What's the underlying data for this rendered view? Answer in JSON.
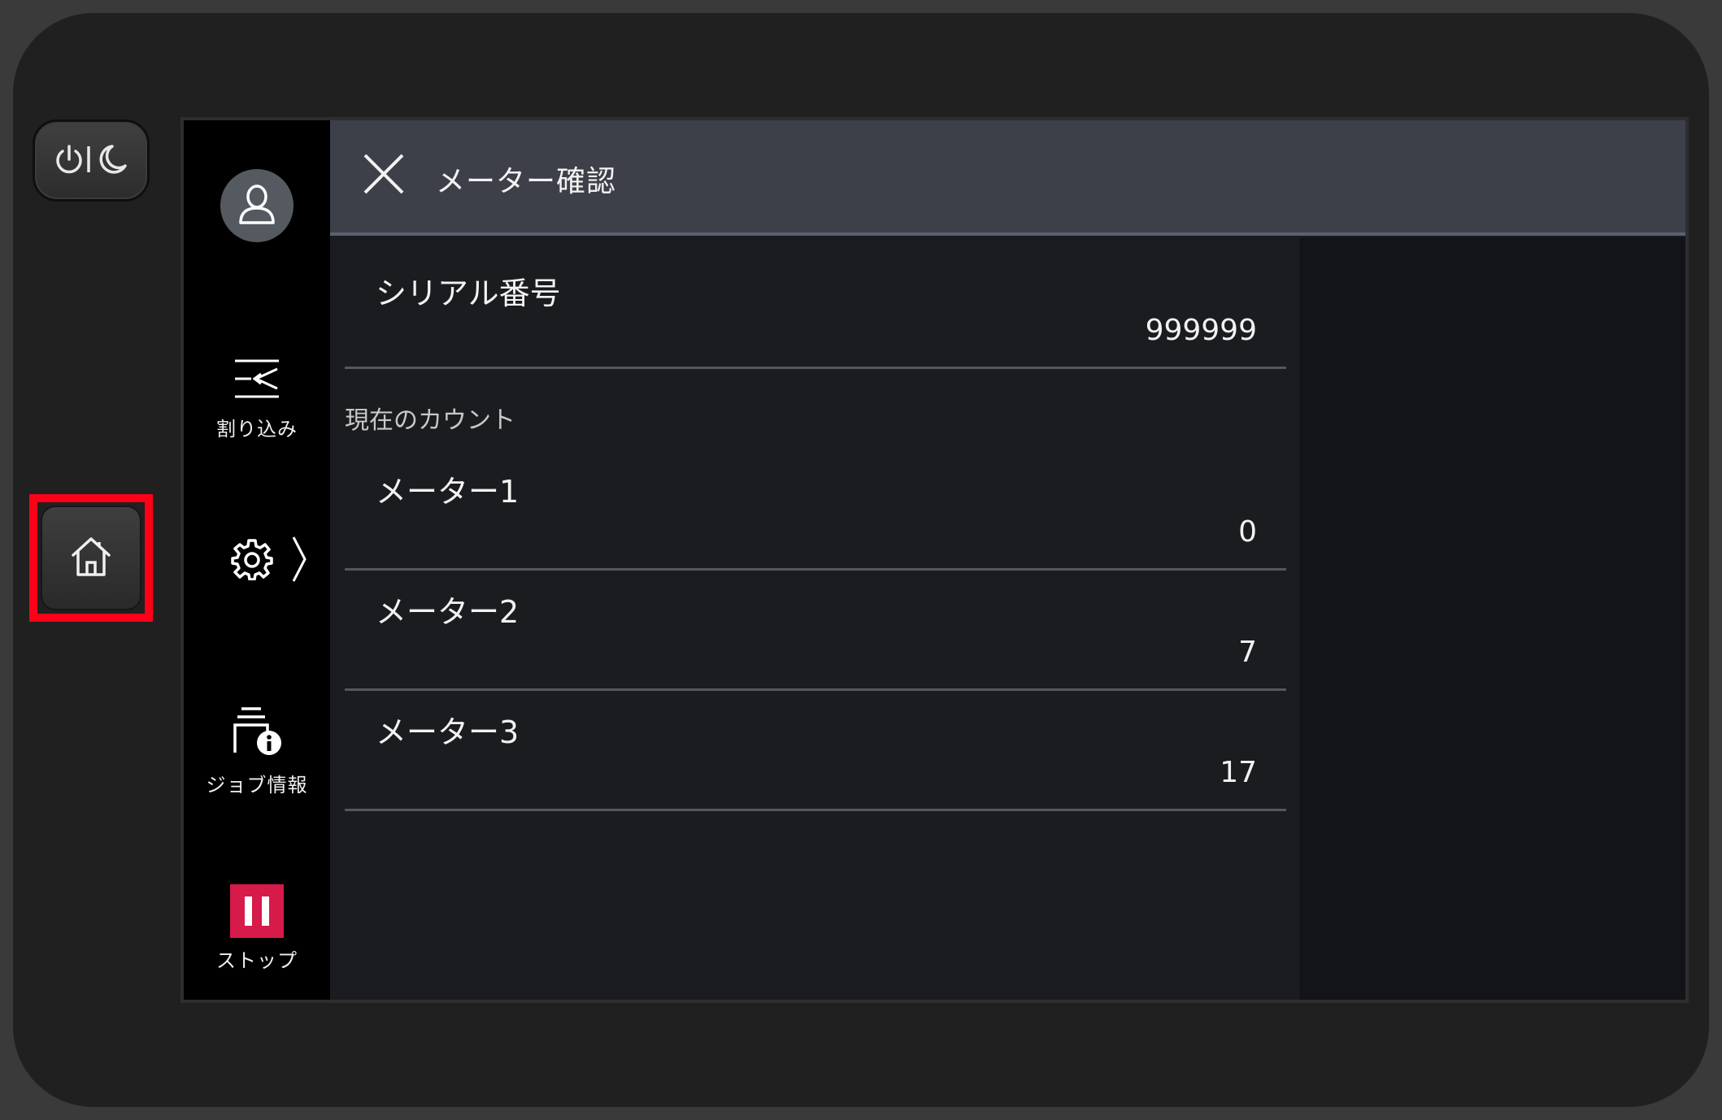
{
  "sidebar": {
    "interrupt_label": "割り込み",
    "job_info_label": "ジョブ情報",
    "stop_label": "ストップ"
  },
  "header": {
    "title": "メーター確認"
  },
  "serial": {
    "label": "シリアル番号",
    "value": "999999"
  },
  "section_label": "現在のカウント",
  "meters": [
    {
      "label": "メーター1",
      "value": "0"
    },
    {
      "label": "メーター2",
      "value": "7"
    },
    {
      "label": "メーター3",
      "value": "17"
    }
  ],
  "colors": {
    "stop_accent": "#d61a4a",
    "highlight": "#ff0019",
    "header_bg": "#3d4049"
  },
  "icons": [
    "power-sleep-icon",
    "home-icon",
    "user-icon",
    "interrupt-icon",
    "gear-icon",
    "chevron-right-icon",
    "job-info-icon",
    "stop-icon",
    "close-icon"
  ]
}
